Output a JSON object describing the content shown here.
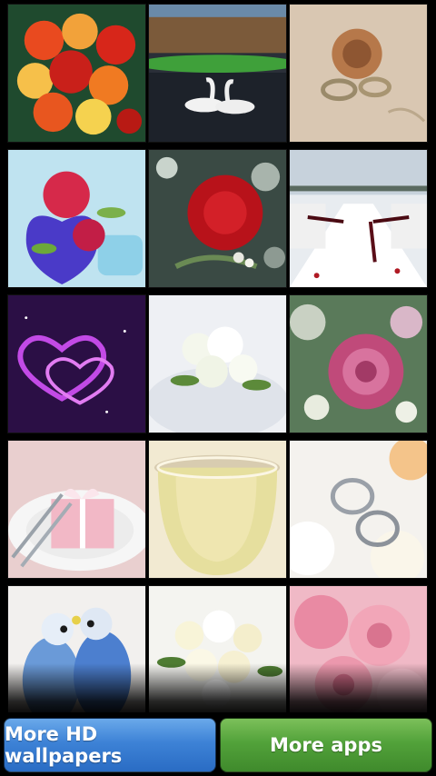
{
  "wallpapers": [
    {
      "subject": "orange-red-rose-bouquet"
    },
    {
      "subject": "swans-on-lake"
    },
    {
      "subject": "rose-and-wedding-rings"
    },
    {
      "subject": "flowers-on-heart-box"
    },
    {
      "subject": "red-rose-with-bokeh"
    },
    {
      "subject": "wedding-aisle-outdoor"
    },
    {
      "subject": "glowing-heart-on-purple"
    },
    {
      "subject": "white-bridal-bouquet"
    },
    {
      "subject": "pink-rose-closeup"
    },
    {
      "subject": "table-setting-with-gift"
    },
    {
      "subject": "champagne-glass"
    },
    {
      "subject": "rings-on-white-flowers"
    },
    {
      "subject": "budgie-couple"
    },
    {
      "subject": "white-rose-bouquet"
    },
    {
      "subject": "pink-roses"
    }
  ],
  "buttons": {
    "more_wallpapers": "More HD wallpapers",
    "more_apps": "More apps"
  },
  "colors": {
    "blue_button": "#3d82d6",
    "green_button": "#52a23a",
    "background": "#000000"
  }
}
